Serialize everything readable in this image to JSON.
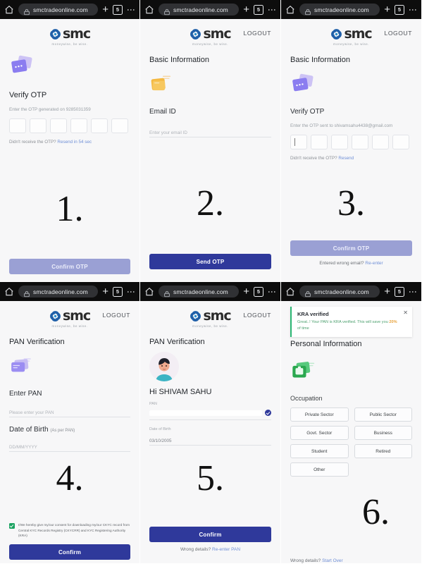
{
  "browser": {
    "url": "smctradeonline.com",
    "tab_count": "5",
    "home_icon": "home-icon",
    "lock_icon": "site-info-lock-icon",
    "new_tab_label": "+",
    "menu_icon": "overflow-menu-icon"
  },
  "brand": {
    "word": "smc",
    "tagline": "moneywise, be wise.",
    "logout": "LOGOUT"
  },
  "panels": [
    {
      "number": "1.",
      "has_logout": false,
      "title": "Verify OTP",
      "illustration": "purple-otp-card-icon",
      "hint": "Enter the OTP generated on 9285031359",
      "otp_boxes": 6,
      "otp_caret": false,
      "resend_prefix": "Didn't receive the OTP?",
      "resend_link": "Resend in 54 sec",
      "button": "Confirm OTP",
      "button_state": "disabled",
      "footnote_prefix": "",
      "footnote_link": ""
    },
    {
      "number": "2.",
      "has_logout": true,
      "heading": "Basic Information",
      "illustration": "orange-envelope-icon",
      "field_label": "Email ID",
      "field_placeholder": "Enter your email ID",
      "button": "Send OTP",
      "button_state": "primary"
    },
    {
      "number": "3.",
      "has_logout": true,
      "heading": "Basic Information",
      "illustration": "purple-otp-card-icon",
      "title": "Verify OTP",
      "hint": "Enter the OTP sent to shivamsahu4438@gmail.com",
      "otp_boxes": 6,
      "otp_caret": true,
      "resend_prefix": "Didn't receive the OTP?",
      "resend_link": "Resend",
      "button": "Confirm OTP",
      "button_state": "disabled",
      "footnote_prefix": "Entered wrong email?",
      "footnote_link": "Re-enter"
    },
    {
      "number": "4.",
      "has_logout": true,
      "heading": "PAN Verification",
      "illustration": "purple-pan-card-icon",
      "pan_label": "Enter PAN",
      "pan_placeholder": "Please enter your PAN",
      "dob_label": "Date of Birth",
      "dob_label_small": "(As per PAN)",
      "dob_placeholder": "DD/MM/YYYY",
      "consent": "I/We hereby give my/our consent for downloading my/our CKYC record from Central KYC Records Registry (CKYCRR) and KYC Registering Authority (KRA)",
      "consent_checked": true,
      "button": "Confirm",
      "button_state": "primary"
    },
    {
      "number": "5.",
      "has_logout": true,
      "heading": "PAN Verification",
      "illustration": "user-avatar-illustration",
      "greeting": "Hi SHIVAM SAHU",
      "pan_label": "PAN",
      "pan_value": "",
      "pan_verified_icon": "check-circle-icon",
      "dob_label": "Date of Birth",
      "dob_value": "03/10/2005",
      "button": "Confirm",
      "button_state": "primary",
      "footnote_prefix": "Wrong details?",
      "footnote_link": "Re-enter PAN"
    },
    {
      "number": "6.",
      "has_logout": false,
      "toast": {
        "title": "KRA verified",
        "body_before": "Great..! Your PAN is KRA verified. This will save you ",
        "body_highlight": "20%",
        "body_after": " of time",
        "close_icon": "close-icon"
      },
      "heading": "Personal Information",
      "illustration": "green-briefcase-icon",
      "occupation_label": "Occupation",
      "occupations": [
        "Private Sector",
        "Public Sector",
        "Govt. Sector",
        "Business",
        "Student",
        "Retired",
        "Other"
      ],
      "footnote_prefix": "Wrong details?",
      "footnote_link": "Start Over"
    }
  ],
  "colors": {
    "primary_button": "#2f399b",
    "disabled_button": "#9aa0d4",
    "link": "#6f8fd6",
    "toast_accent": "#2bb673",
    "checkbox_green": "#1aa260"
  }
}
